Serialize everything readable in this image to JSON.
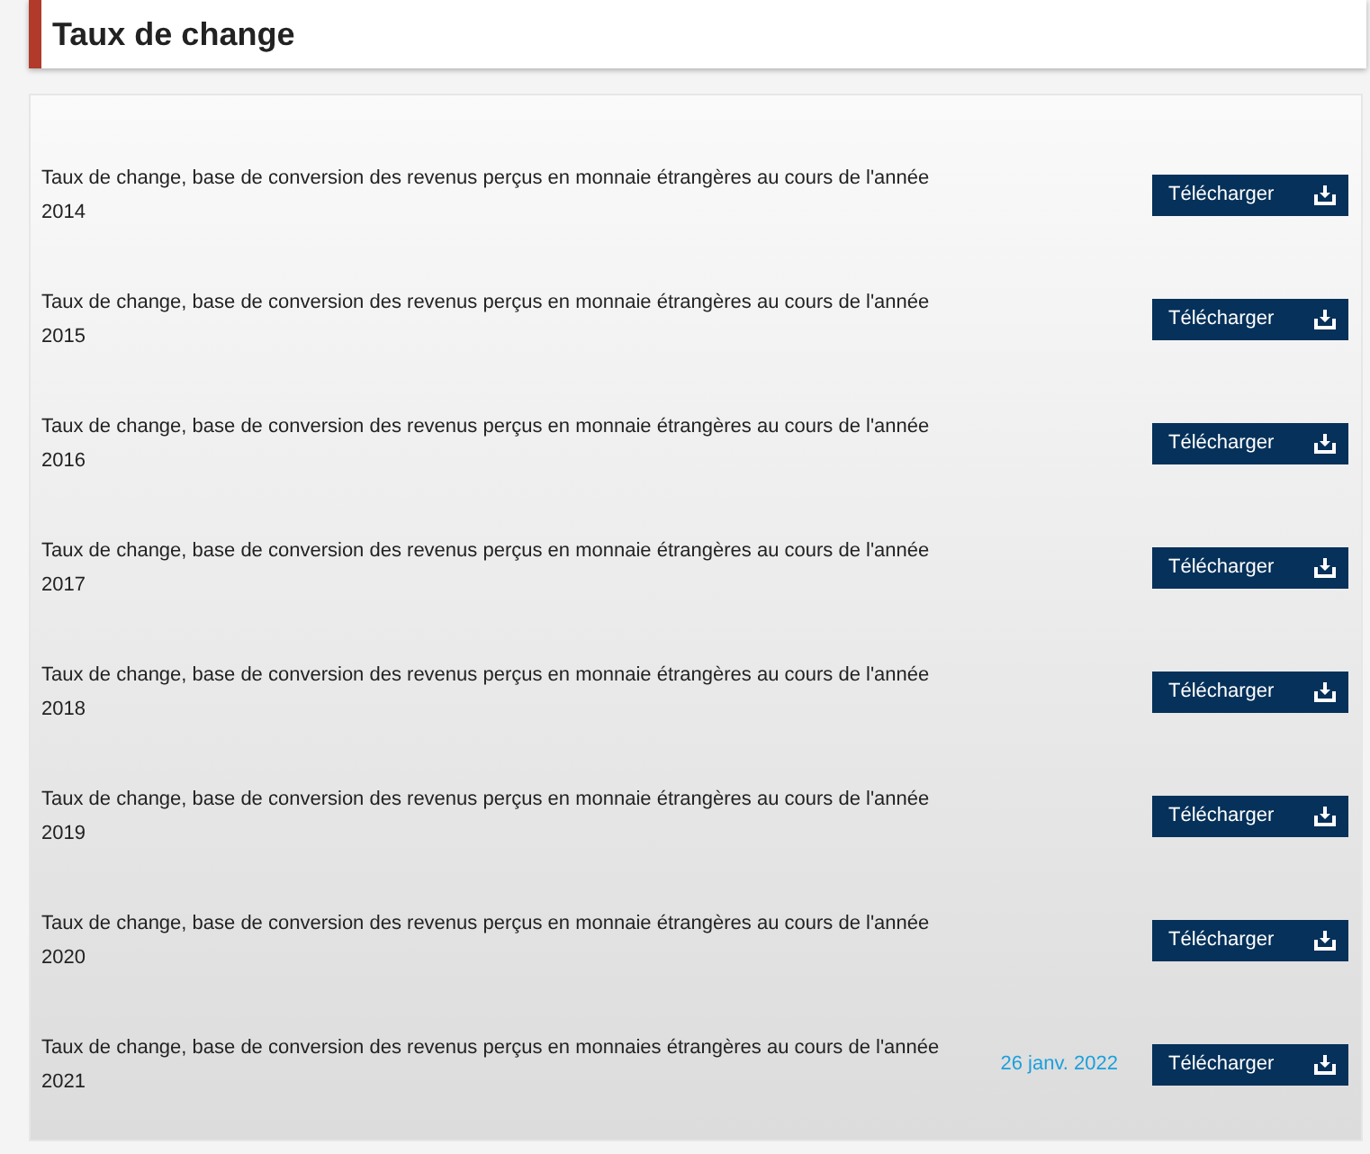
{
  "title": "Taux de change",
  "documents": [
    {
      "description": "Taux de change, base de conversion des revenus perçus en monnaie étrangères au cours de l'année 2014",
      "button": "Télécharger"
    },
    {
      "description": "Taux de change, base de conversion des revenus perçus en monnaie étrangères au cours de l'année 2015",
      "button": "Télécharger"
    },
    {
      "description": "Taux de change, base de conversion des revenus perçus en monnaie étrangères au cours de l'année 2016",
      "button": "Télécharger"
    },
    {
      "description": "Taux de change, base de conversion des revenus perçus en monnaie étrangères au cours de l'année 2017",
      "button": "Télécharger"
    },
    {
      "description": "Taux de change, base de conversion des revenus perçus en monnaie étrangères au cours de l'année 2018",
      "button": "Télécharger"
    },
    {
      "description": "Taux de change, base de conversion des revenus perçus en monnaie étrangères au cours de l'année 2019",
      "button": "Télécharger"
    },
    {
      "description": "Taux de change, base de conversion des revenus perçus en monnaie étrangères au cours de l'année 2020",
      "button": "Télécharger"
    },
    {
      "description": "Taux de change, base de conversion des revenus perçus en monnaies étrangères au cours de l'année 2021",
      "date": "26 janv. 2022",
      "button": "Télécharger"
    }
  ]
}
